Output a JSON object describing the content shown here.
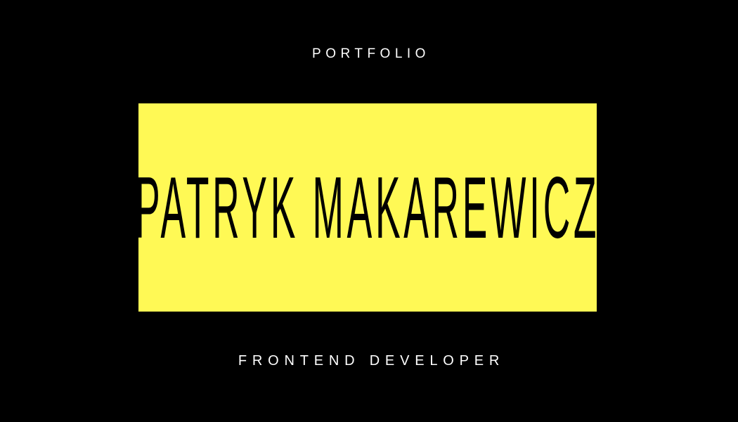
{
  "header": {
    "eyebrow": "PORTFOLIO"
  },
  "hero": {
    "name": "PATRYK MAKAREWICZ",
    "panel_color": "#fff955"
  },
  "footer": {
    "role": "FRONTEND DEVELOPER"
  },
  "theme": {
    "background": "#000000",
    "text": "#ffffff"
  }
}
